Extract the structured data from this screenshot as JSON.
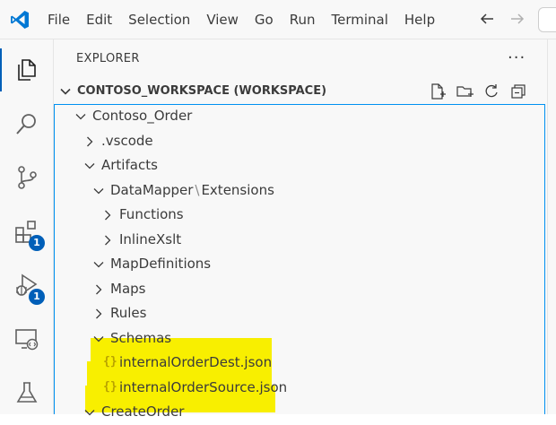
{
  "menu": {
    "items": [
      "File",
      "Edit",
      "Selection",
      "View",
      "Go",
      "Run",
      "Terminal",
      "Help"
    ]
  },
  "activity": {
    "items": [
      {
        "name": "explorer-icon",
        "active": true,
        "badge": ""
      },
      {
        "name": "search-icon",
        "active": false,
        "badge": ""
      },
      {
        "name": "source-control-icon",
        "active": false,
        "badge": ""
      },
      {
        "name": "extensions-icon",
        "active": false,
        "badge": "1"
      },
      {
        "name": "run-debug-icon",
        "active": false,
        "badge": "1"
      },
      {
        "name": "remote-explorer-icon",
        "active": false,
        "badge": ""
      },
      {
        "name": "testing-icon",
        "active": false,
        "badge": ""
      }
    ]
  },
  "sidebar": {
    "header": "EXPLORER",
    "more": "···",
    "section_title": "CONTOSO_WORKSPACE (WORKSPACE)",
    "actions": [
      "new-file-icon",
      "new-folder-icon",
      "refresh-icon",
      "collapse-all-icon"
    ]
  },
  "tree": {
    "rows": [
      {
        "label": "Contoso_Order",
        "depth": 0,
        "expanded": true,
        "type": "folder"
      },
      {
        "label": ".vscode",
        "depth": 1,
        "expanded": false,
        "type": "folder"
      },
      {
        "label": "Artifacts",
        "depth": 1,
        "expanded": true,
        "type": "folder"
      },
      {
        "label": "DataMapper",
        "label2": "Extensions",
        "depth": 2,
        "expanded": true,
        "type": "folder"
      },
      {
        "label": "Functions",
        "depth": 3,
        "expanded": false,
        "type": "folder"
      },
      {
        "label": "InlineXslt",
        "depth": 3,
        "expanded": false,
        "type": "folder"
      },
      {
        "label": "MapDefinitions",
        "depth": 2,
        "expanded": true,
        "type": "folder"
      },
      {
        "label": "Maps",
        "depth": 2,
        "expanded": false,
        "type": "folder"
      },
      {
        "label": "Rules",
        "depth": 2,
        "expanded": false,
        "type": "folder"
      },
      {
        "label": "Schemas",
        "depth": 2,
        "expanded": true,
        "type": "folder",
        "highlight": true
      },
      {
        "label": "internalOrderDest.json",
        "depth": 3,
        "type": "json",
        "highlight": true
      },
      {
        "label": "internalOrderSource.json",
        "depth": 3,
        "type": "json",
        "highlight": true
      },
      {
        "label": "CreateOrder",
        "depth": 1,
        "expanded": true,
        "type": "folder"
      }
    ]
  },
  "colors": {
    "accent": "#005fb8",
    "focus_border": "#0090f1",
    "highlight": "#f8ef00"
  }
}
